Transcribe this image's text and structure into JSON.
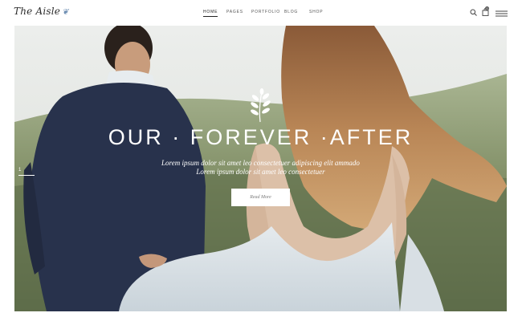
{
  "brand": {
    "logo_text": "The Aisle"
  },
  "nav": {
    "items": [
      {
        "label": "HOME",
        "active": true
      },
      {
        "label": "PAGES",
        "active": false
      },
      {
        "label": "PORTFOLIO",
        "active": false
      },
      {
        "label": "BLOG",
        "active": false
      },
      {
        "label": "SHOP",
        "active": false
      }
    ]
  },
  "header_icons": {
    "search": "search-icon",
    "cart": "shopping-bag-icon",
    "cart_count": "0",
    "menu": "hamburger-menu-icon"
  },
  "hero": {
    "title": "OUR · FOREVER ·AFTER",
    "subtitle_line1": "Lorem ipsum dolor sit amet leo consectetuer adipiscing elit ammado",
    "subtitle_line2": "Lorem ipsum dolor sit amet leo consectetuer",
    "button_label": "Read More",
    "slide_number": "1",
    "ornament": "laurel-branch-icon"
  },
  "colors": {
    "background": "#ffffff",
    "text_dark": "#2c2c2c",
    "hero_text": "#ffffff",
    "logo_accent": "#6f8fb3"
  }
}
